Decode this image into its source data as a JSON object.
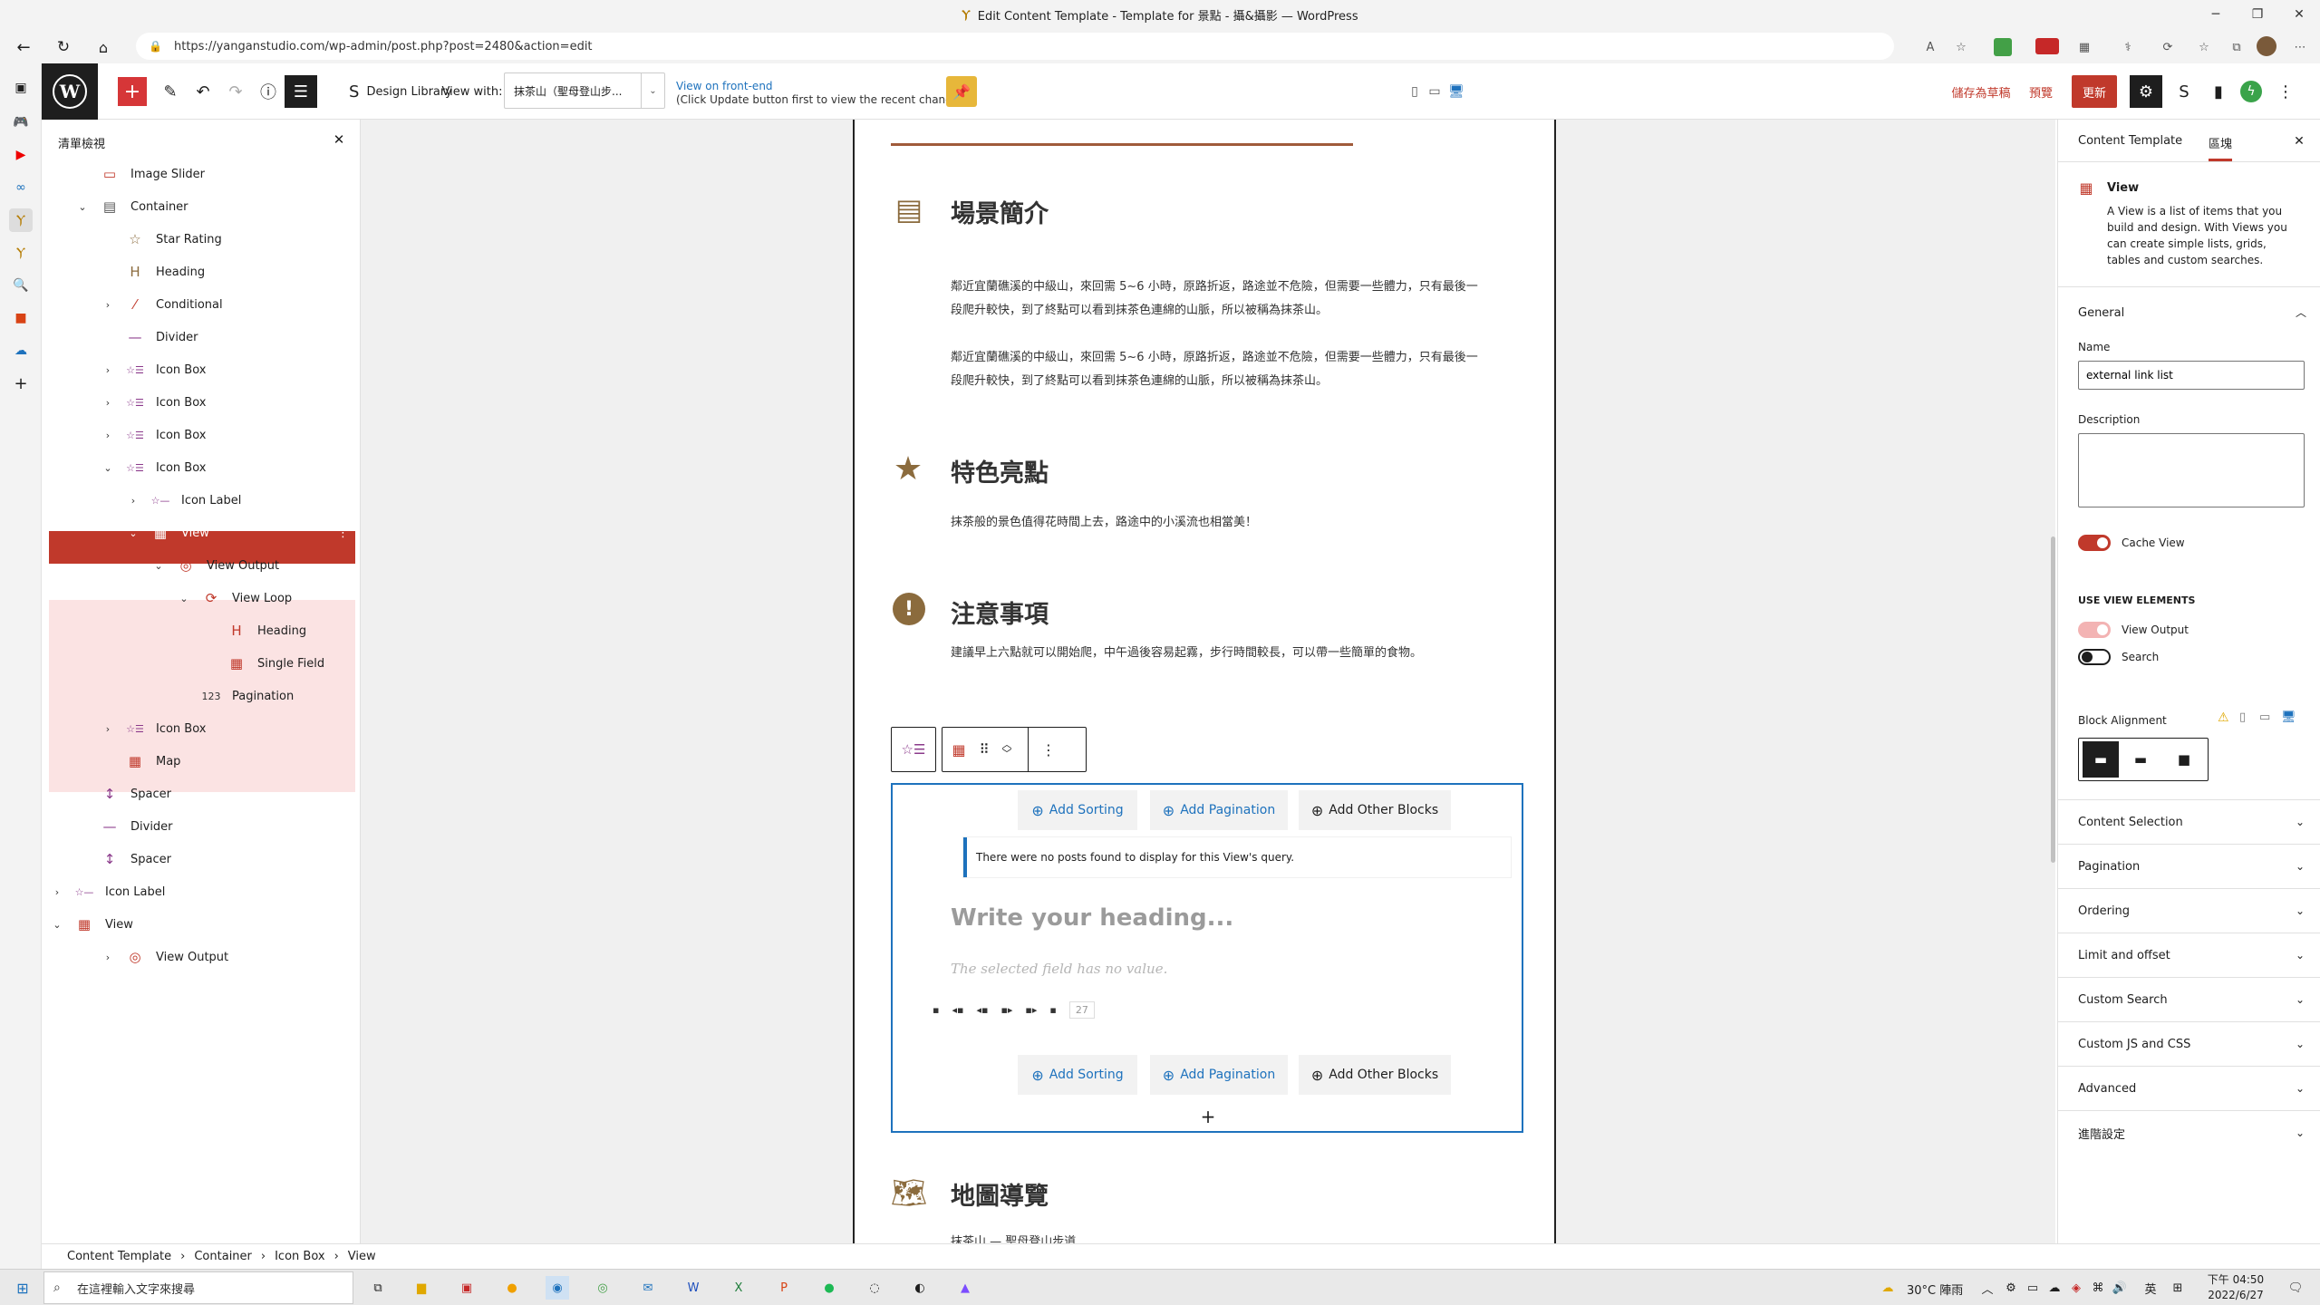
{
  "browser": {
    "window_title": "Edit Content Template - Template for 景點 - 攝&攝影 — WordPress",
    "url": "https://yanganstudio.com/wp-admin/post.php?post=2480&action=edit"
  },
  "toolbar": {
    "design_library_label": "Design Library",
    "view_with_label": "View with:",
    "view_with_value": "抹茶山（聖母登山步...",
    "front_end_link": "View on front-end",
    "front_end_hint": "(Click Update button first to view the recent changes)",
    "save_draft_label": "儲存為草稿",
    "preview_label": "預覽",
    "update_label": "更新"
  },
  "list_view": {
    "title": "清單檢視",
    "items": [
      {
        "label": "Image Slider",
        "icon": "image-slider-icon"
      },
      {
        "label": "Container",
        "icon": "container-icon"
      },
      {
        "label": "Star Rating",
        "icon": "star-icon"
      },
      {
        "label": "Heading",
        "icon": "heading-icon"
      },
      {
        "label": "Conditional",
        "icon": "conditional-icon"
      },
      {
        "label": "Divider",
        "icon": "divider-icon"
      },
      {
        "label": "Icon Box",
        "icon": "icon-box-icon"
      },
      {
        "label": "Icon Box",
        "icon": "icon-box-icon"
      },
      {
        "label": "Icon Box",
        "icon": "icon-box-icon"
      },
      {
        "label": "Icon Box",
        "icon": "icon-box-icon"
      },
      {
        "label": "Icon Label",
        "icon": "icon-label-icon"
      },
      {
        "label": "View",
        "icon": "view-icon"
      },
      {
        "label": "View Output",
        "icon": "view-output-icon"
      },
      {
        "label": "View Loop",
        "icon": "view-loop-icon"
      },
      {
        "label": "Heading",
        "icon": "heading-icon"
      },
      {
        "label": "Single Field",
        "icon": "single-field-icon"
      },
      {
        "label": "Pagination",
        "icon": "pagination-icon"
      },
      {
        "label": "Icon Box",
        "icon": "icon-box-icon"
      },
      {
        "label": "Map",
        "icon": "map-icon"
      },
      {
        "label": "Spacer",
        "icon": "spacer-icon"
      },
      {
        "label": "Divider",
        "icon": "divider-icon"
      },
      {
        "label": "Spacer",
        "icon": "spacer-icon"
      },
      {
        "label": "Icon Label",
        "icon": "icon-label-icon"
      },
      {
        "label": "View",
        "icon": "view-icon"
      },
      {
        "label": "View Output",
        "icon": "view-output-icon"
      }
    ]
  },
  "content": {
    "sec1_title": "場景簡介",
    "sec1_para1_line1": "鄰近宜蘭礁溪的中級山，來回需 5~6 小時，原路折返，路途並不危險，但需要一些體力，只有最後一",
    "sec1_para1_line2": "段爬升較快，到了終點可以看到抹茶色連綿的山脈，所以被稱為抹茶山。",
    "sec1_para2_line1": "鄰近宜蘭礁溪的中級山，來回需 5~6 小時，原路折返，路途並不危險，但需要一些體力，只有最後一",
    "sec1_para2_line2": "段爬升較快，到了終點可以看到抹茶色連綿的山脈，所以被稱為抹茶山。",
    "sec2_title": "特色亮點",
    "sec2_para": "抹茶般的景色值得花時間上去，路途中的小溪流也相當美！",
    "sec3_title": "注意事項",
    "sec3_para": "建議早上六點就可以開始爬，中午過後容易起霧，步行時間較長，可以帶一些簡單的食物。",
    "view_block": {
      "add_sorting": "Add Sorting",
      "add_pagination": "Add Pagination",
      "add_other_blocks": "Add Other Blocks",
      "no_posts": "There were no posts found to display for this View's query.",
      "heading_placeholder": "Write your heading...",
      "field_placeholder": "The selected field has no value.",
      "page_count": "27"
    },
    "sec4_title": "地圖導覽",
    "sec4_para": "抹茶山 — 聖母登山步道"
  },
  "inspector": {
    "tab_template": "Content Template",
    "tab_block": "區塊",
    "block_name": "View",
    "block_desc": "A View is a list of items that you build and design. With Views you can create simple lists, grids, tables and custom searches.",
    "general_title": "General",
    "name_label": "Name",
    "name_value": "external link list",
    "description_label": "Description",
    "cache_view_label": "Cache View",
    "use_view_elements": "USE VIEW ELEMENTS",
    "view_output_label": "View Output",
    "search_label": "Search",
    "block_alignment_label": "Block Alignment",
    "sections": [
      "Content Selection",
      "Pagination",
      "Ordering",
      "Limit and offset",
      "Custom Search",
      "Custom JS and CSS",
      "Advanced",
      "進階設定"
    ]
  },
  "breadcrumb": [
    "Content Template",
    "Container",
    "Icon Box",
    "View"
  ],
  "taskbar": {
    "search_placeholder": "在這裡輸入文字來搜尋",
    "weather": "30°C 陣雨",
    "ime": "英",
    "time": "下午 04:50",
    "date": "2022/6/27"
  },
  "colors": {
    "accent": "#c0392b",
    "brown": "#8b6b3d",
    "selection": "#fbe3e3",
    "wp_blue": "#1e72bd"
  }
}
